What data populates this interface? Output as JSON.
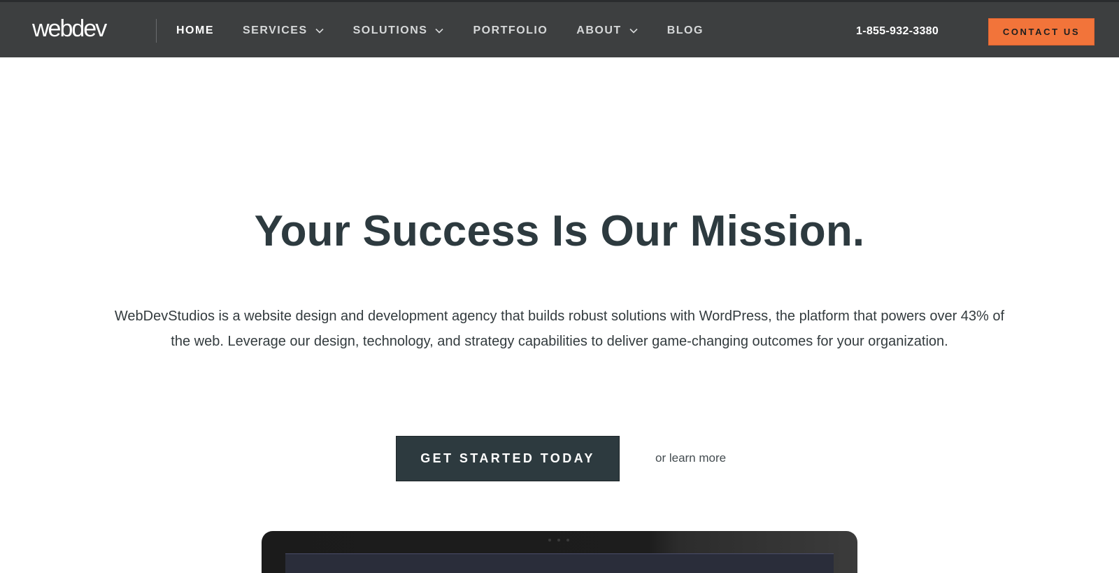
{
  "header": {
    "logo_text": "webdev",
    "nav": [
      {
        "label": "HOME",
        "has_dropdown": false,
        "active": true
      },
      {
        "label": "SERVICES",
        "has_dropdown": true,
        "active": false
      },
      {
        "label": "SOLUTIONS",
        "has_dropdown": true,
        "active": false
      },
      {
        "label": "PORTFOLIO",
        "has_dropdown": false,
        "active": false
      },
      {
        "label": "ABOUT",
        "has_dropdown": true,
        "active": false
      },
      {
        "label": "BLOG",
        "has_dropdown": false,
        "active": false
      }
    ],
    "phone": "1-855-932-3380",
    "contact_label": "CONTACT US"
  },
  "hero": {
    "title": "Your Success Is Our Mission.",
    "description": "WebDevStudios is a website design and development agency that builds robust solutions with WordPress, the platform that powers over 43% of the web. Leverage our design, technology, and strategy capabilities to deliver game-changing outcomes for your organization.",
    "cta_label": "GET STARTED TODAY",
    "learn_more_label": "or learn more"
  },
  "colors": {
    "header_bg": "#3d3f40",
    "accent": "#f2743a",
    "dark": "#2d3a3f",
    "page_bg": "#ffffff"
  },
  "icons": {
    "dropdown": "chevron-down-icon"
  }
}
